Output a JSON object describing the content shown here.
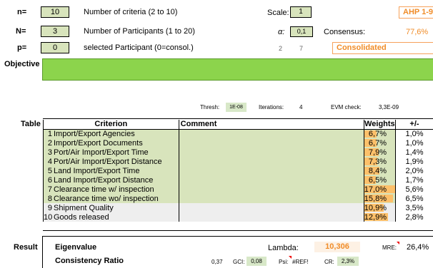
{
  "params": {
    "n_label": "n=",
    "n_value": "10",
    "n_desc": "Number of criteria (2 to 10)",
    "N_label": "N=",
    "N_value": "3",
    "N_desc": "Number of Participants (1 to 20)",
    "p_label": "p=",
    "p_value": "0",
    "p_desc": "selected Participant (0=consol.)",
    "scale_label": "Scale:",
    "scale_value": "1",
    "alpha_label": "α:",
    "alpha_value": "0,1",
    "consensus_label": "Consensus:",
    "consensus_value": "77,6%",
    "ahp_label": "AHP 1-9",
    "p_extra1": "2",
    "p_extra2": "7",
    "consolidated_label": "Consolidated"
  },
  "objective_label": "Objective",
  "stats": {
    "thresh_label": "Thresh:",
    "thresh_value": "1E-08",
    "iter_label": "Iterations:",
    "iter_value": "4",
    "evm_label": "EVM check:",
    "evm_value": "3,3E-09"
  },
  "table": {
    "side_label": "Table",
    "headers": {
      "criterion": "Criterion",
      "comment": "Comment",
      "weights": "Weights",
      "pm": "+/-"
    },
    "rows": [
      {
        "num": "1",
        "criterion": "Import/Export Agencies",
        "weight": "6,7%",
        "w": 0.067,
        "pm": "1,0%"
      },
      {
        "num": "2",
        "criterion": "Import/Export Documents",
        "weight": "6,7%",
        "w": 0.067,
        "pm": "1,0%"
      },
      {
        "num": "3",
        "criterion": "Port/Air Import/Export Time",
        "weight": "7,9%",
        "w": 0.079,
        "pm": "1,4%"
      },
      {
        "num": "4",
        "criterion": "Port/Air Import/Export Distance",
        "weight": "7,3%",
        "w": 0.073,
        "pm": "1,9%"
      },
      {
        "num": "5",
        "criterion": "Land Import/Export Time",
        "weight": "8,4%",
        "w": 0.084,
        "pm": "2,0%"
      },
      {
        "num": "6",
        "criterion": "Land Import/Export Distance",
        "weight": "6,5%",
        "w": 0.065,
        "pm": "1,7%"
      },
      {
        "num": "7",
        "criterion": "Clearance time w/ inspection",
        "weight": "17,0%",
        "w": 0.17,
        "pm": "5,6%"
      },
      {
        "num": "8",
        "criterion": "Clearance time wo/ inspection",
        "weight": "15,8%",
        "w": 0.158,
        "pm": "6,5%"
      },
      {
        "num": "9",
        "criterion": "Shipment Quality",
        "weight": "10,9%",
        "w": 0.109,
        "pm": "3,5%"
      },
      {
        "num": "10",
        "criterion": "Goods released",
        "weight": "12,9%",
        "w": 0.129,
        "pm": "2,8%"
      }
    ]
  },
  "result": {
    "side_label": "Result",
    "eigenvalue_label": "Eigenvalue",
    "lambda_label": "Lambda:",
    "lambda_value": "10,306",
    "mre_label": "MRE:",
    "mre_value": "26,4%",
    "cr_label": "Consistency Ratio",
    "cr_val1": "0,37",
    "gci_label": "GCI:",
    "gci_value": "0,08",
    "psi_label": "Psi:",
    "psi_value": "#REF!",
    "cr2_label": "CR:",
    "cr2_value": "2,3%"
  },
  "colors": {
    "green_band": "#8cd44c",
    "input_green": "#d8e4bc",
    "orange": "#f08c28"
  }
}
